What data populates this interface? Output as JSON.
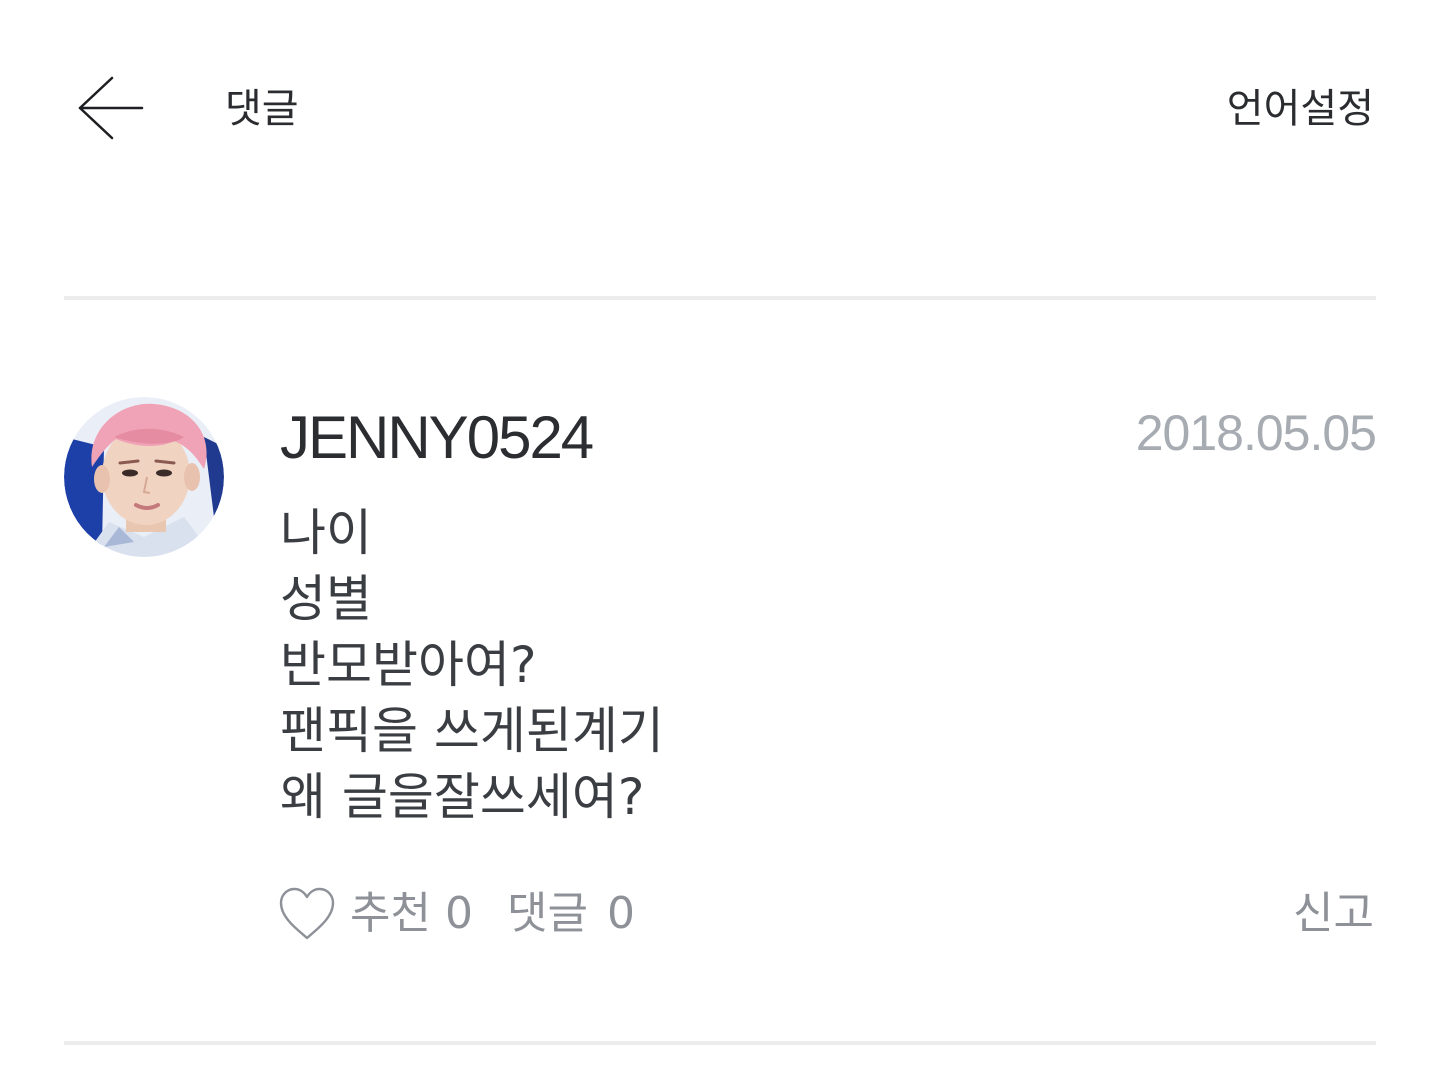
{
  "header": {
    "back_icon": "arrow-left-icon",
    "title": "댓글",
    "language_label": "언어설정"
  },
  "comment": {
    "avatar_icon": "user-avatar",
    "username": "JENNY0524",
    "date": "2018.05.05",
    "lines": [
      "나이",
      "성별",
      "반모받아여?",
      "팬픽을 쓰게된계기",
      "왜 글을잘쓰세여?"
    ],
    "like_icon": "heart-outline-icon",
    "recommend_label": "추천",
    "recommend_count": "0",
    "reply_label": "댓글",
    "reply_count": "0",
    "report_label": "신고"
  },
  "colors": {
    "text_dark": "#2f3236",
    "text_muted": "#8e9298",
    "date_color": "#a7abb2",
    "divider": "#ececec"
  }
}
